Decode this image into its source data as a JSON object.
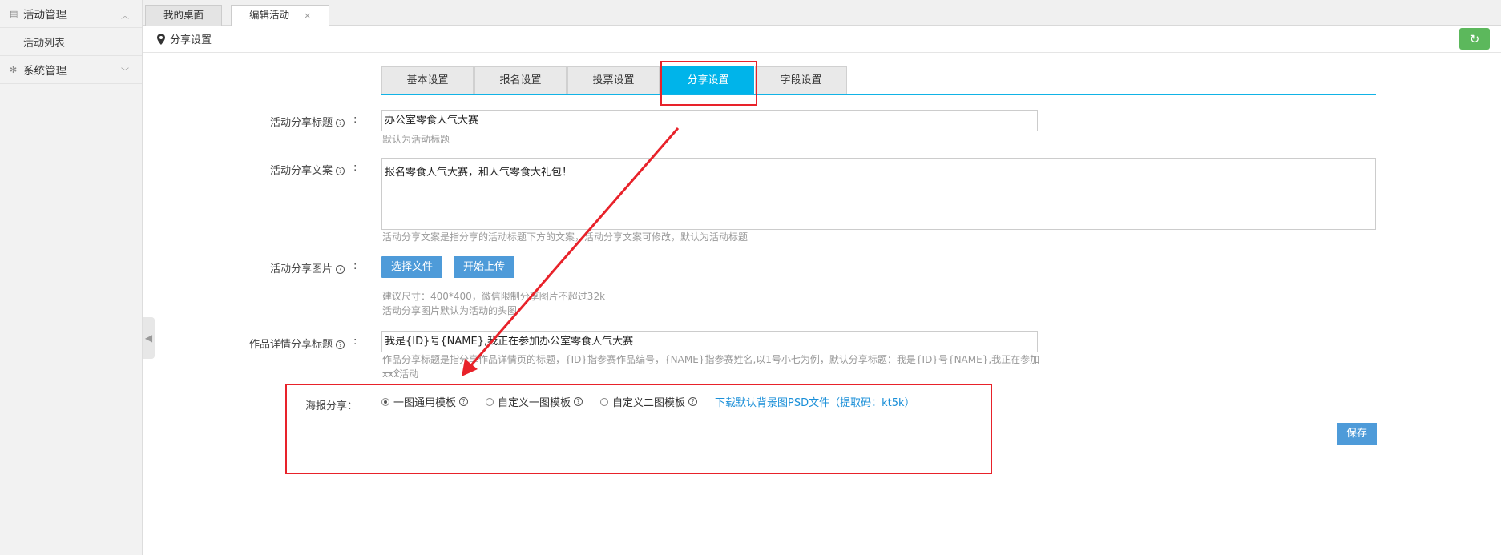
{
  "sidebar": {
    "groups": [
      {
        "label": "活动管理",
        "icon": "list-icon",
        "expanded": true,
        "items": [
          {
            "label": "活动列表"
          }
        ]
      },
      {
        "label": "系统管理",
        "icon": "gear-icon",
        "expanded": false,
        "items": []
      }
    ]
  },
  "tabs": [
    {
      "label": "我的桌面",
      "active": false
    },
    {
      "label": "编辑活动",
      "active": true,
      "close": "×"
    }
  ],
  "breadcrumb": {
    "icon": "location-pin-icon",
    "title": "分享设置"
  },
  "refresh_icon": "refresh-icon",
  "subtabs": [
    "基本设置",
    "报名设置",
    "投票设置",
    "分享设置",
    "字段设置"
  ],
  "active_subtab": "分享设置",
  "form": {
    "share_title": {
      "label": "活动分享标题",
      "value": "办公室零食人气大赛",
      "help": "默认为活动标题"
    },
    "share_text": {
      "label": "活动分享文案",
      "value": "报名零食人气大赛，和人气零食大礼包！",
      "help": "活动分享文案是指分享的活动标题下方的文案，活动分享文案可修改，默认为活动标题"
    },
    "share_image": {
      "label": "活动分享图片",
      "choose_btn": "选择文件",
      "upload_btn": "开始上传",
      "help1": "建议尺寸：400*400，微信限制分享图片不超过32k",
      "help2": "活动分享图片默认为活动的头图"
    },
    "work_share_title": {
      "label": "作品详情分享标题",
      "value": "我是{ID}号{NAME},我正在参加办公室零食人气大赛",
      "help1": "作品分享标题是指分享作品详情页的标题，{ID}指参赛作品编号，{NAME}指参赛姓名,以1号小七为例，默认分享标题：我是{ID}号{NAME},我正在参加一个",
      "help2": "xxx活动"
    },
    "poster": {
      "label": "海报分享：",
      "options": [
        {
          "label": "一图通用模板",
          "selected": true
        },
        {
          "label": "自定义一图模板",
          "selected": false
        },
        {
          "label": "自定义二图模板",
          "selected": false
        }
      ],
      "download_link": "下载默认背景图PSD文件（提取码：kt5k）"
    }
  },
  "save_label": "保存",
  "colors": {
    "accent": "#00b4ea",
    "button": "#4e9bd9",
    "highlight": "#e8222a",
    "refresh": "#5cb85c",
    "link": "#1a8fd8"
  }
}
